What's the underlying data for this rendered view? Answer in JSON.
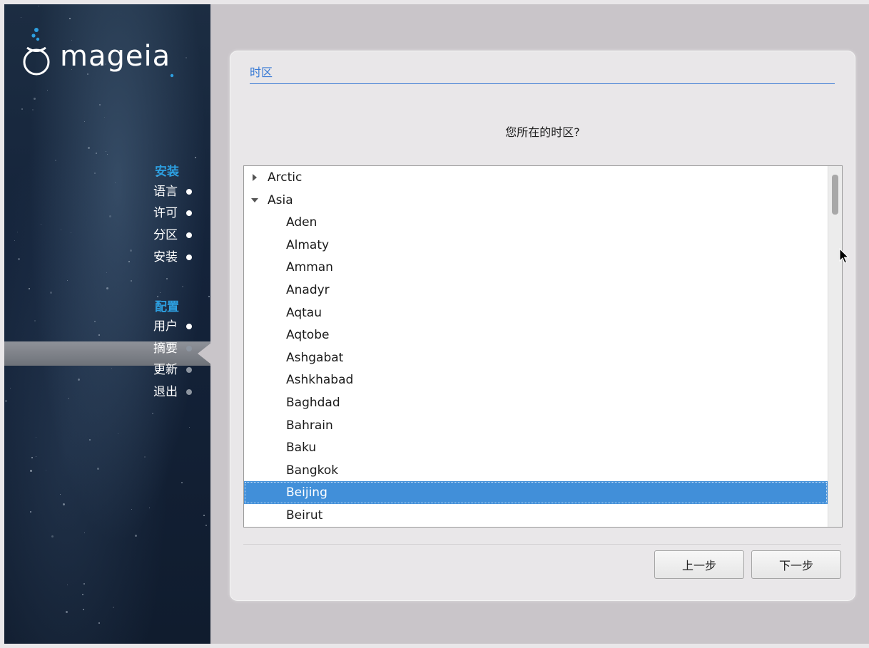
{
  "sidebar": {
    "logo_text": "mageia",
    "sections": [
      {
        "title": "安装",
        "items": [
          {
            "label": "语言",
            "state": "done"
          },
          {
            "label": "许可",
            "state": "done"
          },
          {
            "label": "分区",
            "state": "done"
          },
          {
            "label": "安装",
            "state": "done"
          }
        ]
      },
      {
        "title": "配置",
        "items": [
          {
            "label": "用户",
            "state": "done"
          },
          {
            "label": "摘要",
            "state": "active"
          },
          {
            "label": "更新",
            "state": "pending"
          },
          {
            "label": "退出",
            "state": "pending"
          }
        ]
      }
    ]
  },
  "panel": {
    "title": "时区",
    "question": "您所在的时区?"
  },
  "timezones": {
    "rows": [
      {
        "label": "Arctic",
        "level": 0,
        "expander": "collapsed"
      },
      {
        "label": "Asia",
        "level": 0,
        "expander": "expanded"
      },
      {
        "label": "Aden",
        "level": 1
      },
      {
        "label": "Almaty",
        "level": 1
      },
      {
        "label": "Amman",
        "level": 1
      },
      {
        "label": "Anadyr",
        "level": 1
      },
      {
        "label": "Aqtau",
        "level": 1
      },
      {
        "label": "Aqtobe",
        "level": 1
      },
      {
        "label": "Ashgabat",
        "level": 1
      },
      {
        "label": "Ashkhabad",
        "level": 1
      },
      {
        "label": "Baghdad",
        "level": 1
      },
      {
        "label": "Bahrain",
        "level": 1
      },
      {
        "label": "Baku",
        "level": 1
      },
      {
        "label": "Bangkok",
        "level": 1
      },
      {
        "label": "Beijing",
        "level": 1,
        "selected": true
      },
      {
        "label": "Beirut",
        "level": 1
      }
    ]
  },
  "buttons": {
    "prev": "上一步",
    "next": "下一步"
  },
  "colors": {
    "accent": "#3a7bd5",
    "selection": "#418fd9",
    "sidebar_section": "#2d9fe0"
  }
}
